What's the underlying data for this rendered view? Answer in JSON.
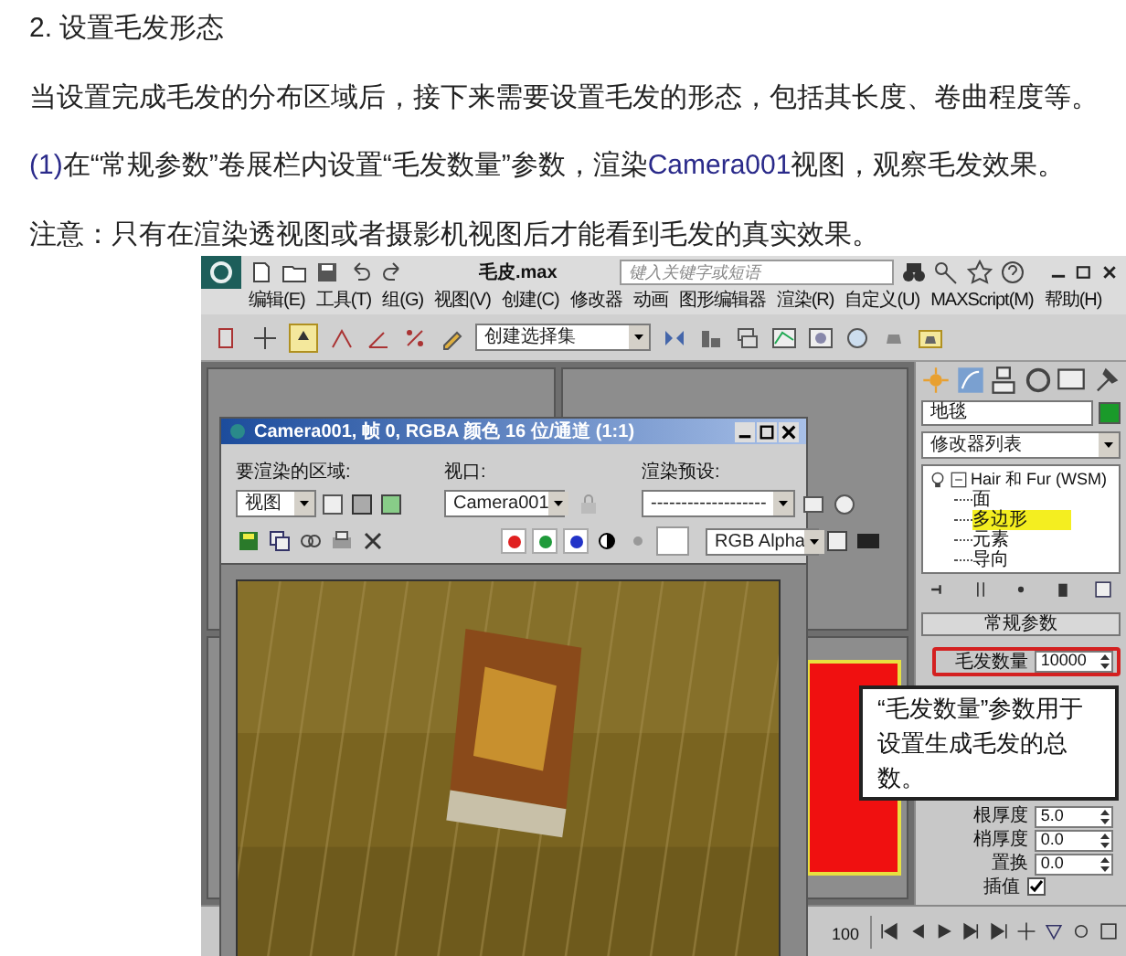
{
  "heading": "2. 设置毛发形态",
  "paragraphs": [
    {
      "segments": [
        {
          "text": "当设置完成毛发的分布区域后，接下来需要设置毛发的形态，包括其长度、卷曲程度等。",
          "kind": "plain"
        }
      ]
    },
    {
      "segments": [
        {
          "text": "(1)",
          "kind": "accent"
        },
        {
          "text": "在“常规参数”卷展栏内设置“毛发数量”参数，渲染",
          "kind": "plain"
        },
        {
          "text": "Camera001",
          "kind": "accent"
        },
        {
          "text": "视图，观察毛发效果。",
          "kind": "plain"
        }
      ]
    },
    {
      "segments": [
        {
          "text": "注意：只有在渲染透视图或者摄影机视图后才能看到毛发的真实效果。",
          "kind": "plain"
        }
      ]
    }
  ],
  "app": {
    "title": "毛皮.max",
    "search": {
      "placeholder": "键入关键字或短语"
    },
    "menu": [
      "编辑(E)",
      "工具(T)",
      "组(G)",
      "视图(V)",
      "创建(C)",
      "修改器",
      "动画",
      "图形编辑器",
      "渲染(R)",
      "自定义(U)",
      "MAXScript(M)",
      "帮助(H)"
    ],
    "toolbar": {
      "selection_set": "创建选择集"
    },
    "render_window": {
      "title": "Camera001, 帧 0, RGBA 颜色 16 位/通道 (1:1)",
      "area_label": "要渲染的区域:",
      "area_value": "视图",
      "viewport_label": "视口:",
      "viewport_value": "Camera001",
      "preset_label": "渲染预设:",
      "preset_value": "-------------------",
      "channels": [
        {
          "color": "#e02020"
        },
        {
          "color": "#1f9a3a"
        },
        {
          "color": "#2233c8"
        }
      ],
      "channel_value": "RGB Alpha"
    },
    "command_panel": {
      "object_name": "地毯",
      "modifier_list": "修改器列表",
      "stack": [
        {
          "label": "Hair 和 Fur (WSM)",
          "children": [
            {
              "label": "面",
              "selected": false
            },
            {
              "label": "多边形",
              "selected": true
            },
            {
              "label": "元素",
              "selected": false
            },
            {
              "label": "导向",
              "selected": false
            }
          ]
        }
      ],
      "rollout": "常规参数",
      "params": [
        {
          "label": "毛发数量",
          "value": "10000",
          "highlighted": true
        }
      ],
      "params_lower": [
        {
          "label": "根厚度",
          "value": "5.0"
        },
        {
          "label": "梢厚度",
          "value": "0.0"
        },
        {
          "label": "置换",
          "value": "0.0"
        }
      ],
      "interpolate": {
        "label": "插值",
        "checked": true
      }
    },
    "callout": "“毛发数量”参数用于设置生成毛发的总数。",
    "timeline": {
      "end": "100"
    }
  }
}
